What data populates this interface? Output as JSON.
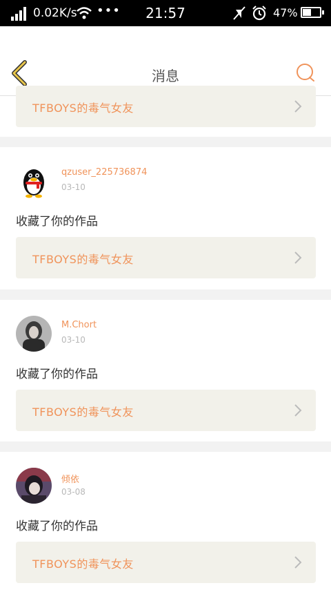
{
  "status_bar": {
    "network_speed": "0.02K/s",
    "time": "21:57",
    "battery": "47%"
  },
  "header": {
    "title": "消息"
  },
  "partial_item": {
    "work_title": "TFBOYS的毒气女友"
  },
  "items": [
    {
      "user": "qzuser_225736874",
      "date": "03-10",
      "action": "收藏了你的作品",
      "work_title": "TFBOYS的毒气女友",
      "avatar": "qq-penguin-avatar"
    },
    {
      "user": "M.Chort",
      "date": "03-10",
      "action": "收藏了你的作品",
      "work_title": "TFBOYS的毒气女友",
      "avatar": "user-photo-avatar"
    },
    {
      "user": "倾依",
      "date": "03-08",
      "action": "收藏了你的作品",
      "work_title": "TFBOYS的毒气女友",
      "avatar": "user-photo-avatar"
    }
  ],
  "colors": {
    "accent": "#f0935a",
    "back_icon": "#e9c64a",
    "card_bg": "#f2f1ea",
    "page_bg": "#f2f2f2"
  }
}
